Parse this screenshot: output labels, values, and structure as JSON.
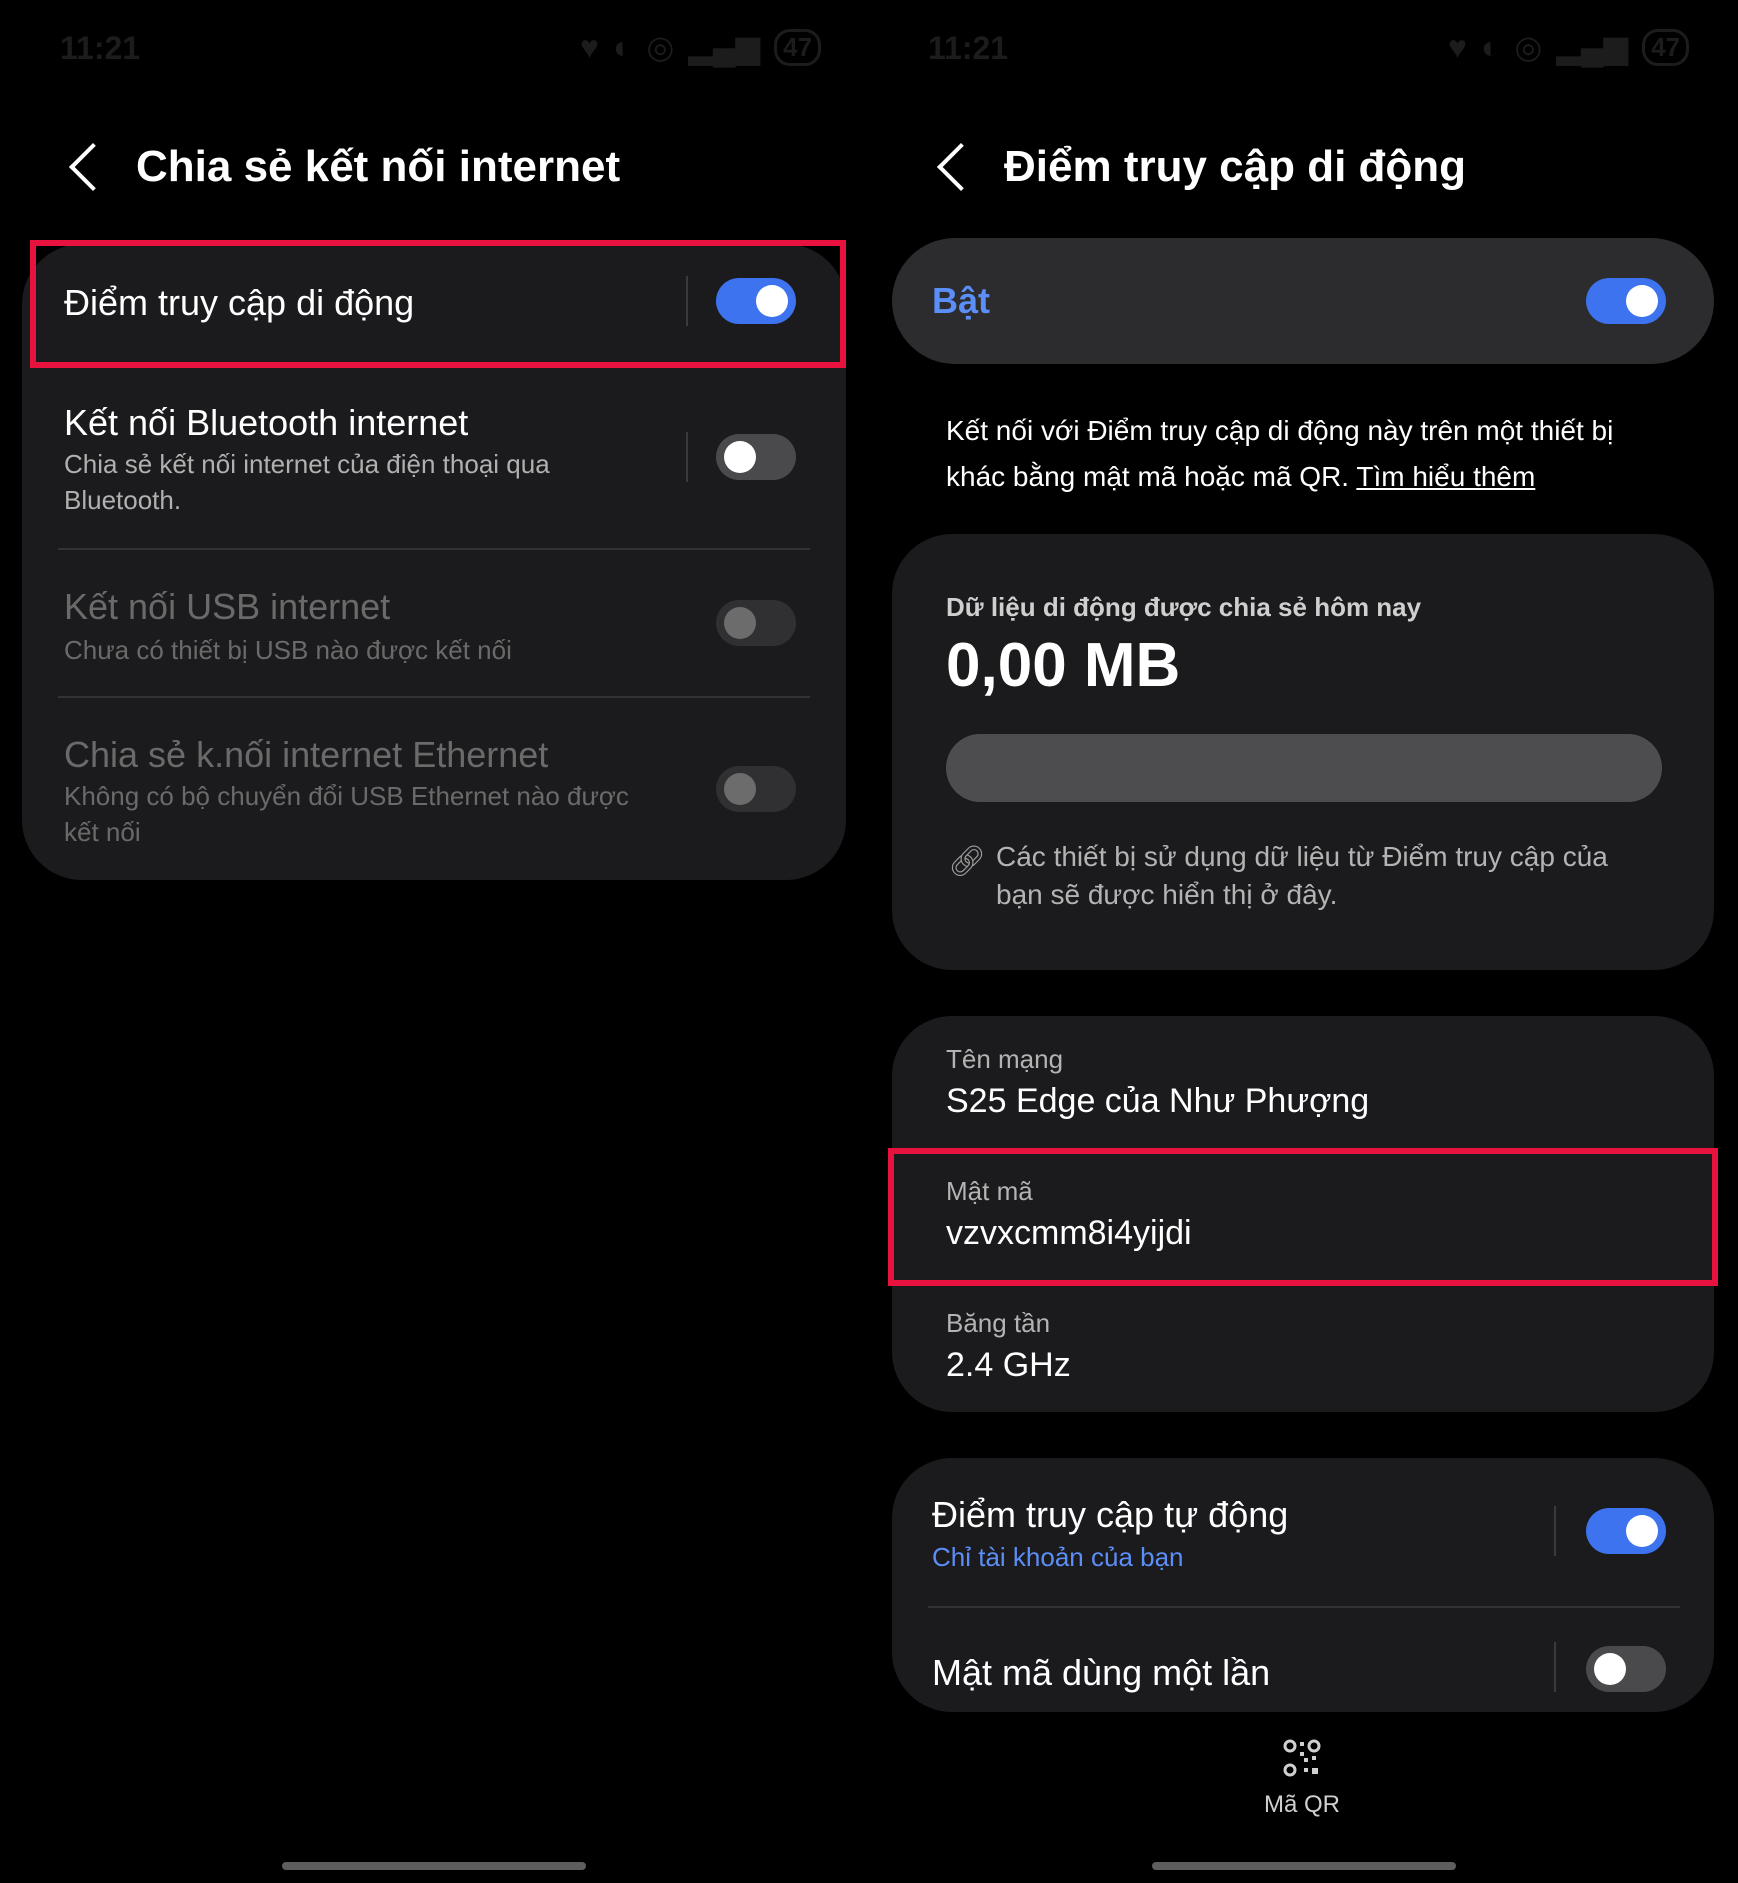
{
  "status_bar": {
    "time": "11:21",
    "battery": "47"
  },
  "left": {
    "title": "Chia sẻ kết nối internet",
    "items": [
      {
        "title": "Điểm truy cập di động",
        "subtitle": "",
        "toggle": "on"
      },
      {
        "title": "Kết nối Bluetooth internet",
        "subtitle": "Chia sẻ kết nối internet của điện thoại qua Bluetooth.",
        "toggle": "off"
      },
      {
        "title": "Kết nối USB internet",
        "subtitle": "Chưa có thiết bị USB nào được kết nối",
        "toggle": "disabled"
      },
      {
        "title": "Chia sẻ k.nối internet Ethernet",
        "subtitle": "Không có bộ chuyển đổi USB Ethernet nào được kết nối",
        "toggle": "disabled"
      }
    ]
  },
  "right": {
    "title": "Điểm truy cập di động",
    "master": {
      "label": "Bật",
      "toggle": "on"
    },
    "description": "Kết nối với Điểm truy cập di động này trên một thiết bị khác bằng mật mã hoặc mã QR.",
    "learn_more": "Tìm hiểu thêm",
    "usage": {
      "label": "Dữ liệu di động được chia sẻ hôm nay",
      "value": "0,00 MB",
      "progress_fraction": 0,
      "devices_note": "Các thiết bị sử dụng dữ liệu từ Điểm truy cập của bạn sẽ được hiển thị ở đây."
    },
    "network_name": {
      "label": "Tên mạng",
      "value": "S25 Edge của Như Phượng"
    },
    "password": {
      "label": "Mật mã",
      "value": "vzvxcmm8i4yijdi"
    },
    "band": {
      "label": "Băng tần",
      "value": "2.4 GHz"
    },
    "auto_hotspot": {
      "title": "Điểm truy cập tự động",
      "subtitle": "Chỉ tài khoản của bạn",
      "toggle": "on"
    },
    "one_time_password": {
      "title": "Mật mã dùng một lần",
      "toggle": "off"
    },
    "qr_button": {
      "label": "Mã QR"
    }
  },
  "colors": {
    "accent": "#3e73f0",
    "highlight": "#e8123f",
    "card": "#1b1b1d",
    "link_blue": "#5b8ef7"
  }
}
